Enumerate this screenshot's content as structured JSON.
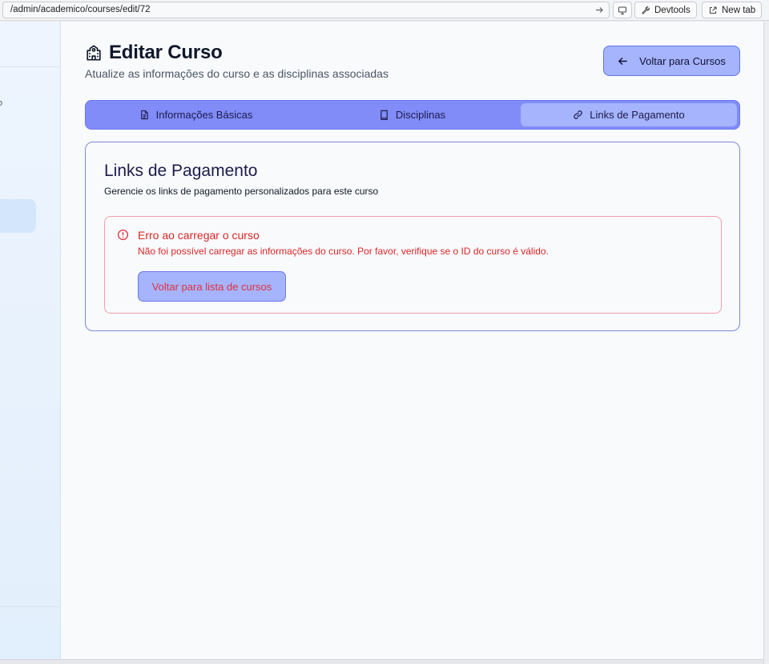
{
  "browser": {
    "url": "/admin/academico/courses/edit/72",
    "devtools_label": "Devtools",
    "newtab_label": "New tab"
  },
  "sidebar": {
    "fragment_text": "o"
  },
  "header": {
    "title": "Editar Curso",
    "subtitle": "Atualize as informações do curso e as disciplinas associadas",
    "back_button_label": "Voltar para Cursos"
  },
  "tabs": [
    {
      "label": "Informações Básicas",
      "icon": "document-icon",
      "active": false
    },
    {
      "label": "Disciplinas",
      "icon": "book-icon",
      "active": false
    },
    {
      "label": "Links de Pagamento",
      "icon": "link-icon",
      "active": true
    }
  ],
  "card": {
    "title": "Links de Pagamento",
    "description": "Gerencie os links de pagamento personalizados para este curso"
  },
  "alert": {
    "title": "Erro ao carregar o curso",
    "message": "Não foi possível carregar as informações do curso. Por favor, verifique se o ID do curso é válido.",
    "button_label": "Voltar para lista de cursos"
  },
  "colors": {
    "accent": "#818cf8",
    "accent_light": "#a5b4fc",
    "error": "#dc2626"
  }
}
